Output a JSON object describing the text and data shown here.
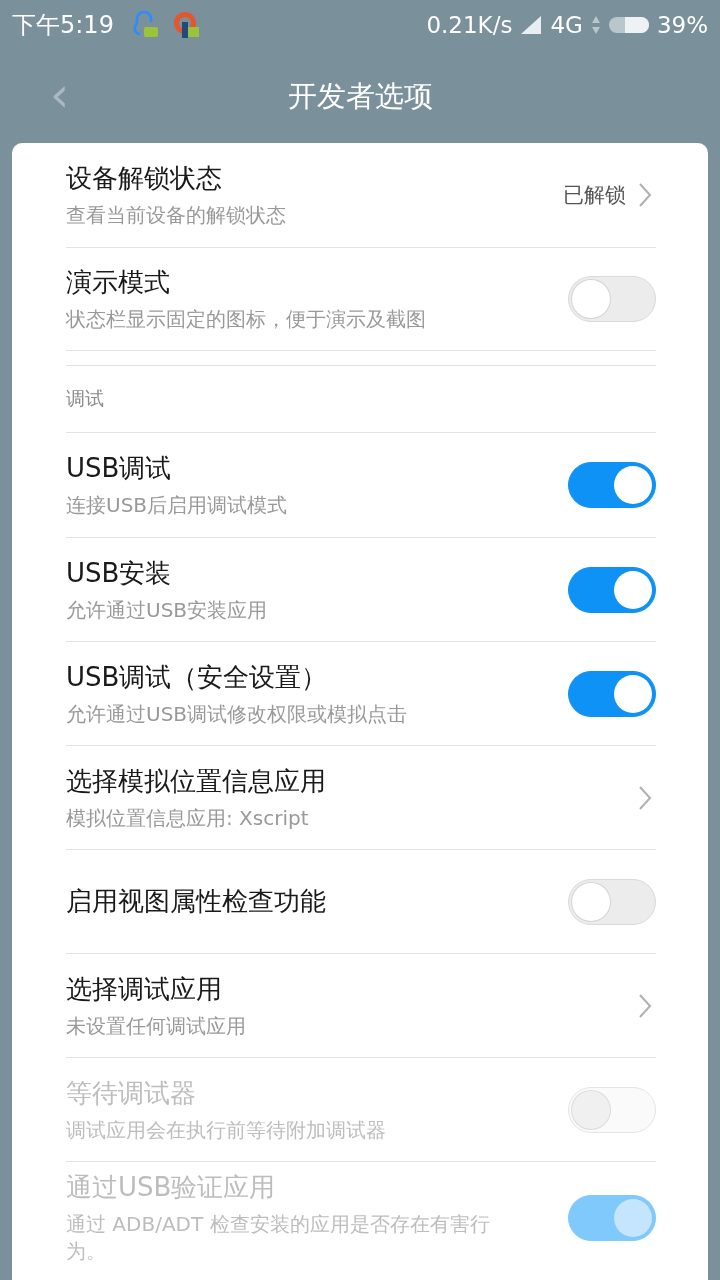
{
  "status_bar": {
    "time": "下午5:19",
    "speed": "0.21K/s",
    "network": "4G",
    "battery": "39%"
  },
  "header": {
    "back": "‹",
    "title": "开发者选项"
  },
  "rows": [
    {
      "kind": "link",
      "title": "设备解锁状态",
      "subtitle": "查看当前设备的解锁状态",
      "value": "已解锁"
    },
    {
      "kind": "toggle",
      "title": "演示模式",
      "subtitle": "状态栏显示固定的图标，便于演示及截图",
      "on": false,
      "disabled": false
    },
    {
      "kind": "section",
      "title": "调试"
    },
    {
      "kind": "toggle",
      "title": "USB调试",
      "subtitle": "连接USB后启用调试模式",
      "on": true,
      "disabled": false
    },
    {
      "kind": "toggle",
      "title": "USB安装",
      "subtitle": "允许通过USB安装应用",
      "on": true,
      "disabled": false
    },
    {
      "kind": "toggle",
      "title": "USB调试（安全设置）",
      "subtitle": "允许通过USB调试修改权限或模拟点击",
      "on": true,
      "disabled": false
    },
    {
      "kind": "link",
      "title": "选择模拟位置信息应用",
      "subtitle": "模拟位置信息应用: Xscript"
    },
    {
      "kind": "toggle",
      "title": "启用视图属性检查功能",
      "on": false,
      "disabled": false
    },
    {
      "kind": "link",
      "title": "选择调试应用",
      "subtitle": "未设置任何调试应用"
    },
    {
      "kind": "toggle",
      "title": "等待调试器",
      "subtitle": "调试应用会在执行前等待附加调试器",
      "on": false,
      "disabled": true
    },
    {
      "kind": "toggle",
      "title": "通过USB验证应用",
      "subtitle": "通过 ADB/ADT 检查安装的应用是否存在有害行为。",
      "on": true,
      "disabled": true
    }
  ]
}
